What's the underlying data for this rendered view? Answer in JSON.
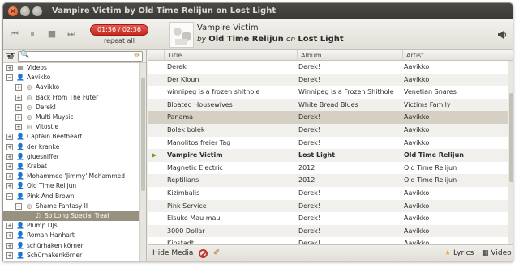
{
  "window": {
    "title": "Vampire Victim by Old Time Relijun on Lost Light",
    "close_glyph": "×"
  },
  "toolbar": {
    "prev_icon": "⏮",
    "pause_icon": "⏸",
    "stop_icon": "■",
    "next_icon": "⏭",
    "time": "01:36 / 02:36",
    "repeat_label": "repeat all",
    "now_playing": {
      "title": "Vampire Victim",
      "by": "by",
      "artist": "Old Time Relijun",
      "on": "on",
      "album": "Lost Light"
    },
    "volume_icon": "speaker-icon"
  },
  "sidebar": {
    "search_value": "",
    "tree": [
      {
        "label": "Videos",
        "icon": "film",
        "depth": 0,
        "expander": "+"
      },
      {
        "label": "Aavikko",
        "icon": "person",
        "depth": 0,
        "expander": "−"
      },
      {
        "label": "Aavikko",
        "icon": "disc",
        "depth": 1,
        "expander": "+"
      },
      {
        "label": "Back From The Futer",
        "icon": "disc",
        "depth": 1,
        "expander": "+"
      },
      {
        "label": "Derek!",
        "icon": "disc",
        "depth": 1,
        "expander": "+"
      },
      {
        "label": "Multi Muysic",
        "icon": "disc",
        "depth": 1,
        "expander": "+"
      },
      {
        "label": "Vitostie",
        "icon": "disc",
        "depth": 1,
        "expander": "+"
      },
      {
        "label": "Captain Beefheart",
        "icon": "person",
        "depth": 0,
        "expander": "+"
      },
      {
        "label": "der kranke",
        "icon": "person",
        "depth": 0,
        "expander": "+"
      },
      {
        "label": "gluesniffer",
        "icon": "person",
        "depth": 0,
        "expander": "+"
      },
      {
        "label": "Krabat",
        "icon": "person",
        "depth": 0,
        "expander": "+"
      },
      {
        "label": "Mohammed 'Jimmy' Mohammed",
        "icon": "person",
        "depth": 0,
        "expander": "+"
      },
      {
        "label": "Old Time Relijun",
        "icon": "person",
        "depth": 0,
        "expander": "+"
      },
      {
        "label": "Pink And Brown",
        "icon": "person",
        "depth": 0,
        "expander": "−"
      },
      {
        "label": "Shame Fantasy II",
        "icon": "disc",
        "depth": 1,
        "expander": "−"
      },
      {
        "label": "So Long Special Treat",
        "icon": "note",
        "depth": 2,
        "expander": "",
        "selected": true
      },
      {
        "label": "Plump DJs",
        "icon": "person",
        "depth": 0,
        "expander": "+"
      },
      {
        "label": "Roman Hanhart",
        "icon": "person",
        "depth": 0,
        "expander": "+"
      },
      {
        "label": "schürhaken körner",
        "icon": "person",
        "depth": 0,
        "expander": "+"
      },
      {
        "label": "Schürhakenkörner",
        "icon": "person",
        "depth": 0,
        "expander": "+"
      }
    ]
  },
  "tracklist": {
    "columns": [
      "Title",
      "Album",
      "Artist"
    ],
    "rows": [
      {
        "title": "Derek",
        "album": "Derek!",
        "artist": "Aavikko"
      },
      {
        "title": "Der Kloun",
        "album": "Derek!",
        "artist": "Aavikko"
      },
      {
        "title": "winnipeg is a frozen shithole",
        "album": "Winnipeg is a Frozen Shithole",
        "artist": "Venetian Snares"
      },
      {
        "title": "Bloated Housewives",
        "album": "White Bread Blues",
        "artist": "Victims Family"
      },
      {
        "title": "Panama",
        "album": "Derek!",
        "artist": "Aavikko",
        "selected": true
      },
      {
        "title": "Bolek bolek",
        "album": "Derek!",
        "artist": "Aavikko"
      },
      {
        "title": "Manolitos freier Tag",
        "album": "Derek!",
        "artist": "Aavikko"
      },
      {
        "title": "Vampire Victim",
        "album": "Lost Light",
        "artist": "Old Time Relijun",
        "playing": true
      },
      {
        "title": "Magnetic Electric",
        "album": "2012",
        "artist": "Old Time Relijun"
      },
      {
        "title": "Reptilians",
        "album": "2012",
        "artist": "Old Time Relijun"
      },
      {
        "title": "Kizimbalis",
        "album": "Derek!",
        "artist": "Aavikko"
      },
      {
        "title": "Pink Service",
        "album": "Derek!",
        "artist": "Aavikko"
      },
      {
        "title": "Elsuko Mau mau",
        "album": "Derek!",
        "artist": "Aavikko"
      },
      {
        "title": "3000 Dollar",
        "album": "Derek!",
        "artist": "Aavikko"
      },
      {
        "title": "Kipstadt",
        "album": "Derek!",
        "artist": "Aavikko"
      }
    ]
  },
  "bottombar": {
    "hide_media": "Hide Media",
    "lyrics": "Lyrics",
    "video": "Video"
  }
}
